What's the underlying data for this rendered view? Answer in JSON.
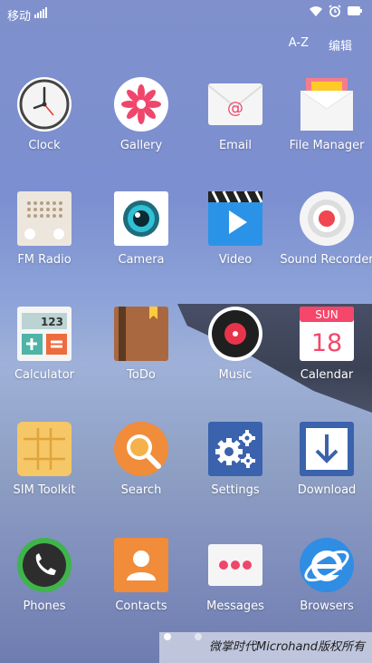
{
  "status_bar": {
    "carrier": "移动"
  },
  "top_actions": {
    "sort": "A-Z",
    "edit": "编辑"
  },
  "apps": [
    {
      "label": "Clock",
      "icon": "clock-icon"
    },
    {
      "label": "Gallery",
      "icon": "gallery-icon"
    },
    {
      "label": "Email",
      "icon": "email-icon"
    },
    {
      "label": "File Manager",
      "icon": "file-manager-icon"
    },
    {
      "label": "FM Radio",
      "icon": "fm-radio-icon"
    },
    {
      "label": "Camera",
      "icon": "camera-icon"
    },
    {
      "label": "Video",
      "icon": "video-icon"
    },
    {
      "label": "Sound Recorder",
      "icon": "sound-recorder-icon"
    },
    {
      "label": "Calculator",
      "icon": "calculator-icon"
    },
    {
      "label": "ToDo",
      "icon": "todo-icon"
    },
    {
      "label": "Music",
      "icon": "music-icon"
    },
    {
      "label": "Calendar",
      "icon": "calendar-icon"
    },
    {
      "label": "SIM Toolkit",
      "icon": "sim-toolkit-icon"
    },
    {
      "label": "Search",
      "icon": "search-icon"
    },
    {
      "label": "Settings",
      "icon": "settings-icon"
    },
    {
      "label": "Download",
      "icon": "download-icon"
    },
    {
      "label": "Phones",
      "icon": "phone-icon"
    },
    {
      "label": "Contacts",
      "icon": "contacts-icon"
    },
    {
      "label": "Messages",
      "icon": "messages-icon"
    },
    {
      "label": "Browsers",
      "icon": "browser-icon"
    }
  ],
  "icon_text": {
    "calculator_display": "123",
    "calendar_day": "SUN",
    "calendar_date": "18"
  },
  "watermark": "微掌时代Microhand版权所有"
}
